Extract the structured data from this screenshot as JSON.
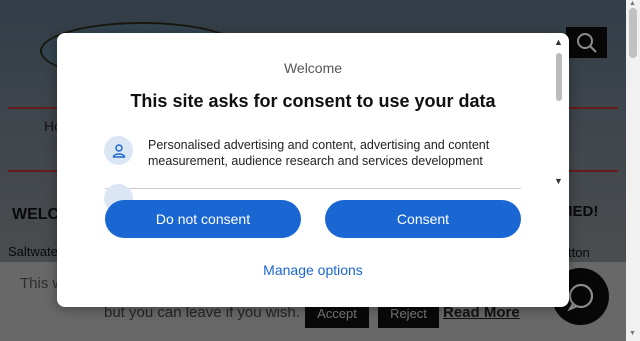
{
  "background": {
    "nav_left": "Ho",
    "nav_right": "l",
    "heading_left": "WELC",
    "heading_right": "MED!",
    "text_left": "Saltwate",
    "text_right": "tton"
  },
  "cookie_bar": {
    "line1": "This w",
    "line2": "but you can leave if you wish.",
    "accept_label": "Accept",
    "reject_label": "Reject",
    "read_more_label": "Read More"
  },
  "dialog": {
    "welcome": "Welcome",
    "title": "This site asks for consent to use your data",
    "purposes": [
      {
        "icon": "person-icon",
        "text": "Personalised advertising and content, advertising and content measurement, audience research and services development"
      }
    ],
    "do_not_consent_label": "Do not consent",
    "consent_label": "Consent",
    "manage_options_label": "Manage options"
  },
  "colors": {
    "accent": "#1a66d2",
    "overlay": "rgba(0,0,0,0.45)",
    "icon_bg": "#dbe6f4"
  }
}
